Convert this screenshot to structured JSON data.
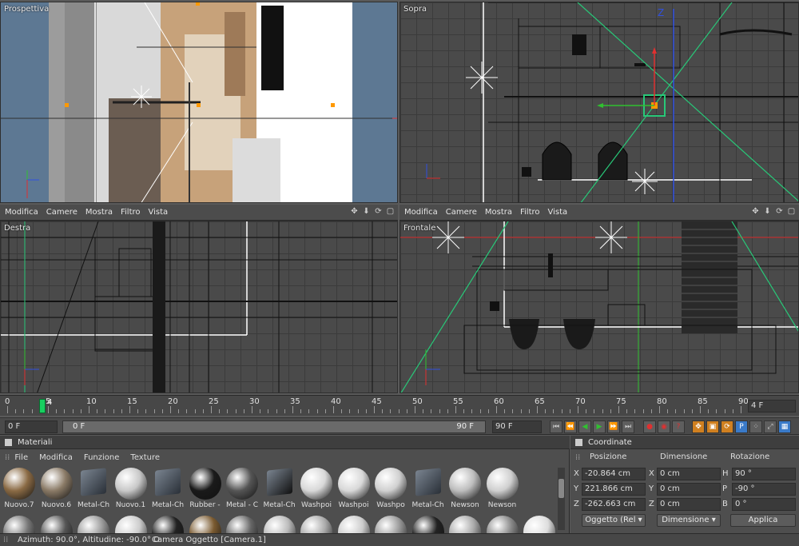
{
  "viewports": {
    "perspective": {
      "label": "Prospettiva"
    },
    "top": {
      "label": "Sopra"
    },
    "right": {
      "label": "Destra"
    },
    "front": {
      "label": "Frontale"
    },
    "menu": [
      "Modifica",
      "Camere",
      "Mostra",
      "Filtro",
      "Vista"
    ],
    "axes": {
      "x": "X",
      "y": "Y",
      "z": "Z"
    }
  },
  "timeline": {
    "ticks": [
      "0",
      "5",
      "10",
      "15",
      "20",
      "25",
      "30",
      "35",
      "40",
      "45",
      "50",
      "55",
      "60",
      "65",
      "70",
      "75",
      "80",
      "85",
      "90"
    ],
    "current_marker": "4",
    "current_frame": "4 F"
  },
  "controls": {
    "start_frame": "0 F",
    "range_start": "0 F",
    "range_end": "90 F",
    "end_frame": "90 F"
  },
  "materials": {
    "title": "Materiali",
    "menu": [
      "File",
      "Modifica",
      "Funzione",
      "Texture"
    ],
    "items": [
      {
        "label": "Nuovo.7",
        "kind": "ball",
        "color": "#8a6a44"
      },
      {
        "label": "Nuovo.6",
        "kind": "ball",
        "color": "#8a7a66"
      },
      {
        "label": "Metal-Ch",
        "kind": "cube",
        "color": "#2a3038"
      },
      {
        "label": "Nuovo.1",
        "kind": "ball",
        "color": "#c8c8c8"
      },
      {
        "label": "Metal-Ch",
        "kind": "cube",
        "color": "#2a3038"
      },
      {
        "label": "Rubber -",
        "kind": "ball",
        "color": "#1a1a1a"
      },
      {
        "label": "Metal - C",
        "kind": "ball",
        "color": "#555555"
      },
      {
        "label": "Metal-Ch",
        "kind": "cube",
        "color": "#111111"
      },
      {
        "label": "Washpoi",
        "kind": "ball",
        "color": "#d8d8d8"
      },
      {
        "label": "Washpoi",
        "kind": "ball",
        "color": "#d8d8d8"
      },
      {
        "label": "Washpo",
        "kind": "ball",
        "color": "#d0d0d0"
      },
      {
        "label": "Metal-Ch",
        "kind": "cube",
        "color": "#2a3038"
      },
      {
        "label": "Newson",
        "kind": "ball",
        "color": "#bdbdbd"
      },
      {
        "label": "Newson",
        "kind": "ball",
        "color": "#cfcfcf"
      }
    ],
    "row2_colors": [
      "#777777",
      "#555555",
      "#9a9a9a",
      "#cccccc",
      "#222222",
      "#7a5a30",
      "#666666",
      "#bbbbbb",
      "#aaaaaa",
      "#cccccc",
      "#999999",
      "#222222",
      "#aaaaaa",
      "#888888",
      "#dddddd"
    ]
  },
  "coordinates": {
    "title": "Coordinate",
    "col_position": "Posizione",
    "col_dimension": "Dimensione",
    "col_rotation": "Rotazione",
    "rows": [
      {
        "axis": "X",
        "pos": "-20.864 cm",
        "dim_axis": "X",
        "dim": "0 cm",
        "rot_axis": "H",
        "rot": "90 °"
      },
      {
        "axis": "Y",
        "pos": "221.866 cm",
        "dim_axis": "Y",
        "dim": "0 cm",
        "rot_axis": "P",
        "rot": "-90 °"
      },
      {
        "axis": "Z",
        "pos": "-262.663 cm",
        "dim_axis": "Z",
        "dim": "0 cm",
        "rot_axis": "B",
        "rot": "0 °"
      }
    ],
    "mode_select": "Oggetto (Rel",
    "dimension_select": "Dimensione",
    "apply_label": "Applica"
  },
  "status": {
    "text": "Azimuth: 90.0°, Altitudine: -90.0°  O",
    "camera": "Camera Oggetto [Camera.1]"
  },
  "colors": {
    "axis_x": "#e03030",
    "axis_y": "#30c030",
    "axis_z": "#3050e0",
    "camera_green": "#28c878",
    "selection": "#2a7fd0"
  }
}
